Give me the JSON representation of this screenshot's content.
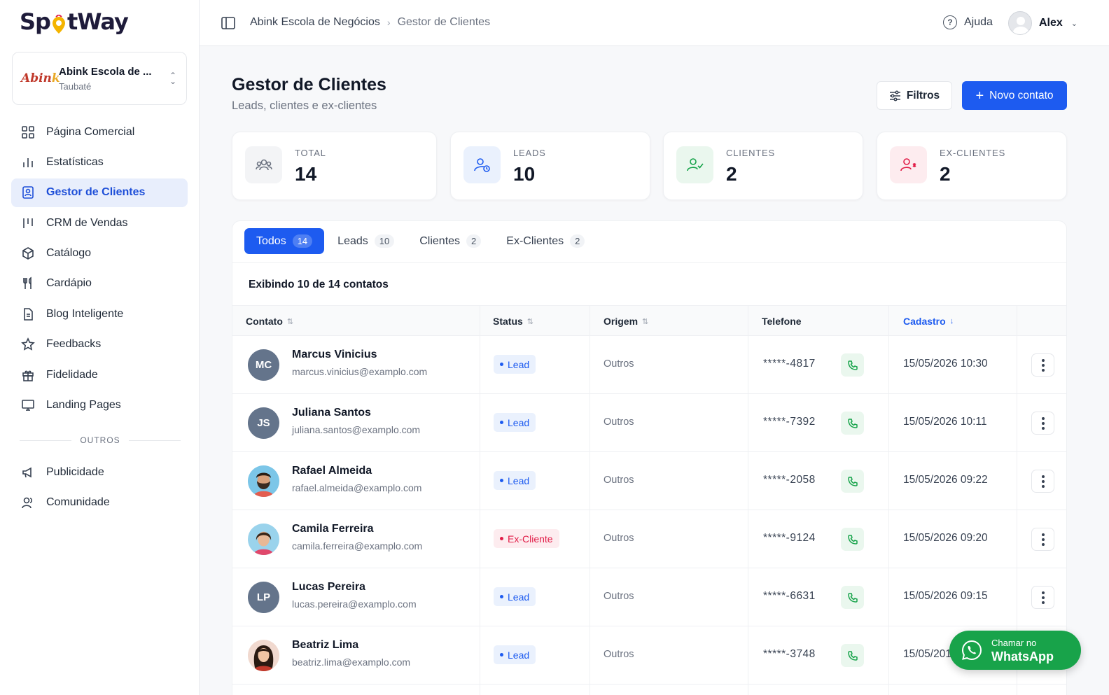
{
  "app": {
    "logo_left": "Sp",
    "logo_right": "tWay"
  },
  "business": {
    "name": "Abink Escola de ...",
    "city": "Taubaté",
    "logo_a": "Abin",
    "logo_b": "k"
  },
  "sidebar": {
    "items": [
      {
        "label": "Página Comercial",
        "icon": "grid-icon"
      },
      {
        "label": "Estatísticas",
        "icon": "bar-chart-icon"
      },
      {
        "label": "Gestor de Clientes",
        "icon": "contact-book-icon",
        "active": true
      },
      {
        "label": "CRM de Vendas",
        "icon": "kanban-icon"
      },
      {
        "label": "Catálogo",
        "icon": "package-icon"
      },
      {
        "label": "Cardápio",
        "icon": "utensils-icon"
      },
      {
        "label": "Blog Inteligente",
        "icon": "document-icon"
      },
      {
        "label": "Feedbacks",
        "icon": "star-icon"
      },
      {
        "label": "Fidelidade",
        "icon": "gift-icon"
      },
      {
        "label": "Landing Pages",
        "icon": "monitor-icon"
      }
    ],
    "section_label": "OUTROS",
    "other_items": [
      {
        "label": "Publicidade",
        "icon": "megaphone-icon"
      },
      {
        "label": "Comunidade",
        "icon": "users-icon"
      }
    ]
  },
  "topbar": {
    "breadcrumb": [
      "Abink Escola de Negócios",
      "Gestor de Clientes"
    ],
    "help_label": "Ajuda",
    "user_name": "Alex"
  },
  "page": {
    "title": "Gestor de Clientes",
    "subtitle": "Leads, clientes e ex-clientes",
    "filter_label": "Filtros",
    "new_contact_label": "Novo contato"
  },
  "stats": [
    {
      "label": "TOTAL",
      "value": "14",
      "color": "#6b7280"
    },
    {
      "label": "LEADS",
      "value": "10",
      "color": "#1d5bf0"
    },
    {
      "label": "CLIENTES",
      "value": "2",
      "color": "#16a34a"
    },
    {
      "label": "EX-CLIENTES",
      "value": "2",
      "color": "#e11d48"
    }
  ],
  "tabs": [
    {
      "label": "Todos",
      "count": "14",
      "active": true
    },
    {
      "label": "Leads",
      "count": "10"
    },
    {
      "label": "Clientes",
      "count": "2"
    },
    {
      "label": "Ex-Clientes",
      "count": "2"
    }
  ],
  "table": {
    "showing_text": "Exibindo 10 de 14 contatos",
    "headers": {
      "contact": "Contato",
      "status": "Status",
      "origin": "Origem",
      "phone": "Telefone",
      "created": "Cadastro"
    },
    "rows": [
      {
        "initials": "MC",
        "name": "Marcus Vinicius",
        "email": "marcus.vinicius@examplo.com",
        "status": "Lead",
        "origin": "Outros",
        "phone": "*****-4817",
        "date": "15/05/2026 10:30"
      },
      {
        "initials": "JS",
        "name": "Juliana Santos",
        "email": "juliana.santos@examplo.com",
        "status": "Lead",
        "origin": "Outros",
        "phone": "*****-7392",
        "date": "15/05/2026 10:11"
      },
      {
        "initials": "",
        "avatar": "man-beard",
        "name": "Rafael Almeida",
        "email": "rafael.almeida@examplo.com",
        "status": "Lead",
        "origin": "Outros",
        "phone": "*****-2058",
        "date": "15/05/2026 09:22"
      },
      {
        "initials": "",
        "avatar": "woman-short",
        "name": "Camila Ferreira",
        "email": "camila.ferreira@examplo.com",
        "status": "Ex-Cliente",
        "origin": "Outros",
        "phone": "*****-9124",
        "date": "15/05/2026 09:20"
      },
      {
        "initials": "LP",
        "name": "Lucas Pereira",
        "email": "lucas.pereira@examplo.com",
        "status": "Lead",
        "origin": "Outros",
        "phone": "*****-6631",
        "date": "15/05/2026 09:15"
      },
      {
        "initials": "",
        "avatar": "woman-long",
        "name": "Beatriz Lima",
        "email": "beatriz.lima@examplo.com",
        "status": "Lead",
        "origin": "Outros",
        "phone": "*****-3748",
        "date": "15/05/201"
      }
    ]
  },
  "whatsapp": {
    "line1": "Chamar no",
    "line2": "WhatsApp",
    "color": "#18a34a"
  }
}
